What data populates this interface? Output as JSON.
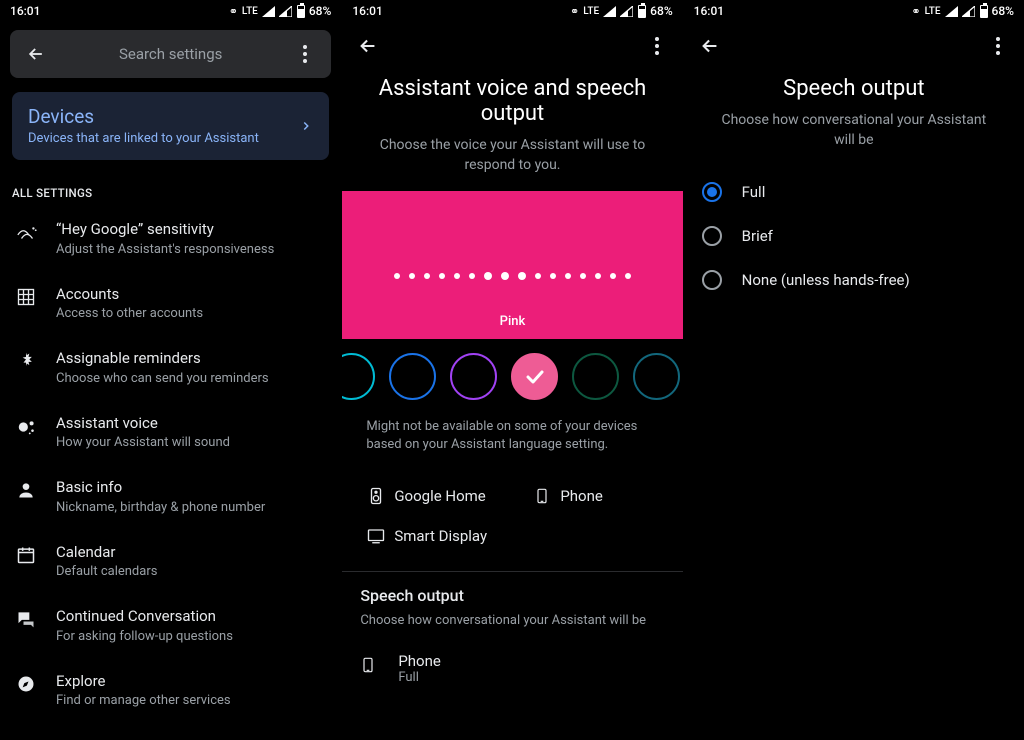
{
  "status": {
    "time": "16:01",
    "lte": "LTE",
    "battery_pct": "68%"
  },
  "panel1": {
    "search_placeholder": "Search settings",
    "devices_card": {
      "title": "Devices",
      "subtitle": "Devices that are linked to your Assistant"
    },
    "all_settings_label": "ALL SETTINGS",
    "items": [
      {
        "title": "“Hey Google” sensitivity",
        "subtitle": "Adjust the Assistant's responsiveness"
      },
      {
        "title": "Accounts",
        "subtitle": "Access to other accounts"
      },
      {
        "title": "Assignable reminders",
        "subtitle": "Choose who can send you reminders"
      },
      {
        "title": "Assistant voice",
        "subtitle": "How your Assistant will sound"
      },
      {
        "title": "Basic info",
        "subtitle": "Nickname, birthday & phone number"
      },
      {
        "title": "Calendar",
        "subtitle": "Default calendars"
      },
      {
        "title": "Continued Conversation",
        "subtitle": "For asking follow-up questions"
      },
      {
        "title": "Explore",
        "subtitle": "Find or manage other services"
      }
    ]
  },
  "panel2": {
    "title": "Assistant voice and speech output",
    "subtitle": "Choose the voice your Assistant will use to respond to you.",
    "preview_label": "Pink",
    "color_options": [
      {
        "name": "cyan",
        "border": "#00bcd4"
      },
      {
        "name": "blue",
        "border": "#1a73e8"
      },
      {
        "name": "purple",
        "border": "#a142f4"
      },
      {
        "name": "pink",
        "border": "#ee5c95",
        "selected": true
      },
      {
        "name": "green",
        "border": "#0d5840"
      },
      {
        "name": "teal",
        "border": "#12677c"
      }
    ],
    "footnote": "Might not be available on some of your devices based on your Assistant language setting.",
    "devices": [
      {
        "label": "Google Home"
      },
      {
        "label": "Phone"
      },
      {
        "label": "Smart Display"
      }
    ],
    "speech_output": {
      "heading": "Speech output",
      "desc": "Choose how conversational your Assistant will be",
      "phone_label": "Phone",
      "phone_value": "Full"
    }
  },
  "panel3": {
    "title": "Speech output",
    "subtitle": "Choose how conversational your Assistant will be",
    "options": [
      {
        "label": "Full",
        "selected": true
      },
      {
        "label": "Brief"
      },
      {
        "label": "None (unless hands-free)"
      }
    ]
  }
}
